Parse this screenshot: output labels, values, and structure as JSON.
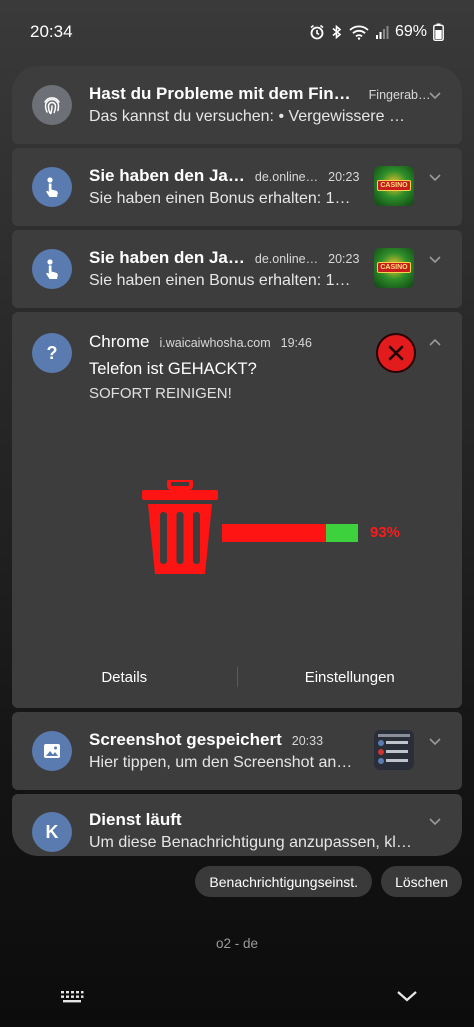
{
  "status_bar": {
    "time": "20:34",
    "battery": "69%",
    "icons": [
      "alarm-icon",
      "bluetooth-icon",
      "wifi-icon",
      "signal-icon",
      "battery-icon"
    ]
  },
  "notifications": [
    {
      "icon": "fingerprint-icon",
      "title": "Hast du Probleme mit dem Fin…",
      "meta": "Fingerab…",
      "body": "Das kannst du versuchen: • Vergewissere …"
    },
    {
      "icon": "touch-icon",
      "title": "Sie haben den Ja…",
      "source": "de.online…",
      "time": "20:23",
      "body": "Sie haben einen Bonus erhalten: 1…",
      "thumb": "casino-thumbnail",
      "thumb_text": "CASINO"
    },
    {
      "icon": "touch-icon",
      "title": "Sie haben den Ja…",
      "source": "de.online…",
      "time": "20:23",
      "body": "Sie haben einen Bonus erhalten: 1…",
      "thumb": "casino-thumbnail",
      "thumb_text": "CASINO"
    }
  ],
  "chrome": {
    "app": "Chrome",
    "source": "i.waicaiwhosha.com",
    "time": "19:46",
    "headline": "Telefon ist GEHACKT?",
    "subline": "SOFORT REINIGEN!",
    "progress_percent": 93,
    "progress_label": "93%",
    "actions": [
      "Details",
      "Einstellungen"
    ]
  },
  "lower_notifications": [
    {
      "icon": "image-icon",
      "title": "Screenshot gespeichert",
      "time": "20:33",
      "body": "Hier tippen, um den Screenshot an…"
    },
    {
      "icon": "k-icon",
      "title": "Dienst läuft",
      "body": "Um diese Benachrichtigung anzupassen, kl…"
    }
  ],
  "buttons": {
    "settings": "Benachrichtigungseinst.",
    "clear": "Löschen"
  },
  "carrier": "o2 - de",
  "colors": {
    "card": "#3d3d3d",
    "icon_blue": "#5a7bb0",
    "alert_red": "#ff1414",
    "progress_green": "#3dd13d"
  }
}
